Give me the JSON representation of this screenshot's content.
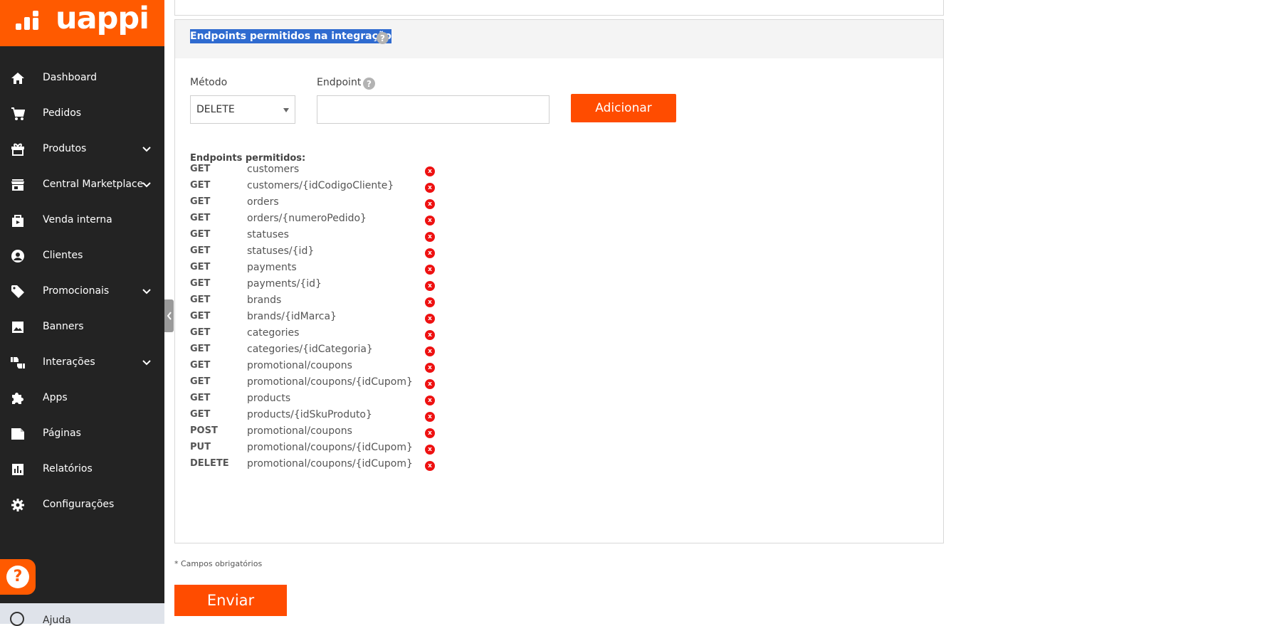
{
  "brand": {
    "name": "uappi",
    "color": "#ff5a00"
  },
  "sidebar": {
    "items": [
      {
        "label": "Dashboard",
        "icon": "home-icon",
        "expandable": false
      },
      {
        "label": "Pedidos",
        "icon": "cart-icon",
        "expandable": false
      },
      {
        "label": "Produtos",
        "icon": "gift-box-icon",
        "expandable": true
      },
      {
        "label": "Central Marketplace",
        "icon": "store-icon",
        "expandable": true
      },
      {
        "label": "Venda interna",
        "icon": "shopping-bag-icon",
        "expandable": false
      },
      {
        "label": "Clientes",
        "icon": "user-circle-icon",
        "expandable": false
      },
      {
        "label": "Promocionais",
        "icon": "tag-icon",
        "expandable": true
      },
      {
        "label": "Banners",
        "icon": "image-icon",
        "expandable": false
      },
      {
        "label": "Interações",
        "icon": "thumbs-icon",
        "expandable": true
      },
      {
        "label": "Apps",
        "icon": "puzzle-icon",
        "expandable": false
      },
      {
        "label": "Páginas",
        "icon": "page-icon",
        "expandable": false
      },
      {
        "label": "Relatórios",
        "icon": "bar-chart-icon",
        "expandable": false
      },
      {
        "label": "Configurações",
        "icon": "gear-icon",
        "expandable": false
      }
    ],
    "help_label": "Ajuda",
    "help_fab": "?"
  },
  "card": {
    "title": "Endpoints permitidos na integração",
    "help_glyph": "?",
    "method_label": "Método",
    "method_value": "DELETE",
    "endpoint_label": "Endpoint",
    "endpoint_value": "",
    "add_button": "Adicionar",
    "allowed_title": "Endpoints permitidos:",
    "delete_glyph": "x",
    "endpoints": [
      {
        "method": "GET",
        "path": "customers"
      },
      {
        "method": "GET",
        "path": "customers/{idCodigoCliente}"
      },
      {
        "method": "GET",
        "path": "orders"
      },
      {
        "method": "GET",
        "path": "orders/{numeroPedido}"
      },
      {
        "method": "GET",
        "path": "statuses"
      },
      {
        "method": "GET",
        "path": "statuses/{id}"
      },
      {
        "method": "GET",
        "path": "payments"
      },
      {
        "method": "GET",
        "path": "payments/{id}"
      },
      {
        "method": "GET",
        "path": "brands"
      },
      {
        "method": "GET",
        "path": "brands/{idMarca}"
      },
      {
        "method": "GET",
        "path": "categories"
      },
      {
        "method": "GET",
        "path": "categories/{idCategoria}"
      },
      {
        "method": "GET",
        "path": "promotional/coupons"
      },
      {
        "method": "GET",
        "path": "promotional/coupons/{idCupom}"
      },
      {
        "method": "GET",
        "path": "products"
      },
      {
        "method": "GET",
        "path": "products/{idSkuProduto}"
      },
      {
        "method": "POST",
        "path": "promotional/coupons"
      },
      {
        "method": "PUT",
        "path": "promotional/coupons/{idCupom}"
      },
      {
        "method": "DELETE",
        "path": "promotional/coupons/{idCupom}"
      }
    ]
  },
  "footer": {
    "required_note": "* Campos obrigatórios",
    "submit_button": "Enviar"
  }
}
